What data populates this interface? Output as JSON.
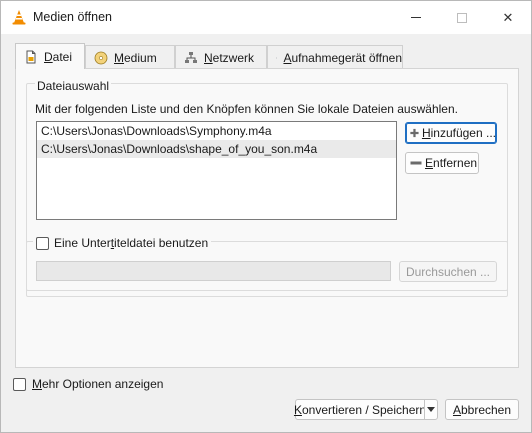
{
  "window": {
    "title": "Medien öffnen",
    "minimize_glyph": "",
    "close_glyph": "✕"
  },
  "tabs": [
    {
      "label_pre": "",
      "label_ul": "D",
      "label_post": "atei",
      "icon": "file-icon"
    },
    {
      "label_pre": "",
      "label_ul": "M",
      "label_post": "edium",
      "icon": "disc-icon"
    },
    {
      "label_pre": "",
      "label_ul": "N",
      "label_post": "etzwerk",
      "icon": "network-icon"
    },
    {
      "label_pre": "",
      "label_ul": "A",
      "label_post": "ufnahmegerät öffnen",
      "icon": "capture-device-icon"
    }
  ],
  "file_selection": {
    "group_label": "Dateiauswahl",
    "description": "Mit der folgenden Liste und den Knöpfen können Sie lokale Dateien auswählen.",
    "files": [
      "C:\\Users\\Jonas\\Downloads\\Symphony.m4a",
      "C:\\Users\\Jonas\\Downloads\\shape_of_you_son.m4a"
    ],
    "add_label_ul": "H",
    "add_label_rest": "inzufügen ...",
    "remove_label_ul": "E",
    "remove_label_rest": "ntfernen"
  },
  "subtitle": {
    "checkbox_label_pre": "Eine Unter",
    "checkbox_label_ul": "t",
    "checkbox_label_post": "iteldatei benutzen",
    "checked": false,
    "path_value": "",
    "browse_label": "Durchsuchen ..."
  },
  "footer": {
    "more_options_pre": "",
    "more_options_ul": "M",
    "more_options_post": "ehr Optionen anzeigen",
    "convert_ul": "K",
    "convert_rest": "onvertieren / Speichern",
    "cancel_ul": "A",
    "cancel_rest": "bbrechen"
  },
  "colors": {
    "vlc_orange": "#f28c00",
    "accent_blue": "#1f6fc3"
  }
}
